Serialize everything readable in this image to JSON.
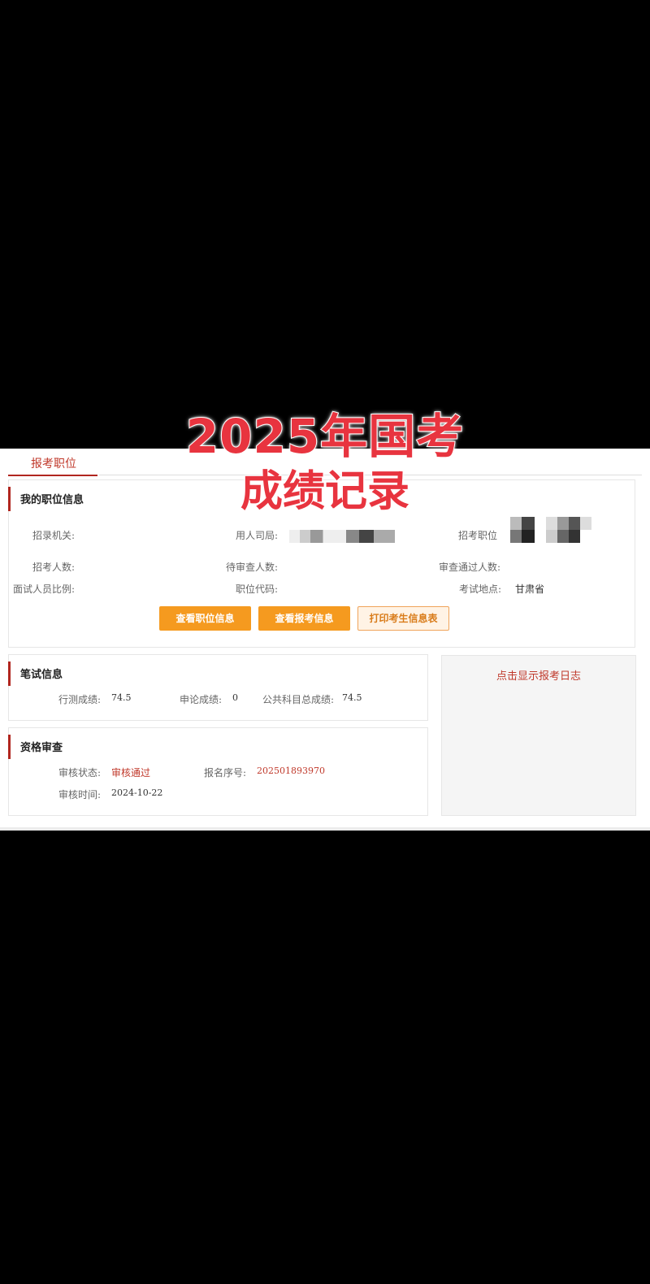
{
  "overlay": {
    "line1": "2025年国考",
    "line2": "成绩记录"
  },
  "tab": {
    "label": "报考职位"
  },
  "position_info": {
    "title": "我的职位信息",
    "fields": {
      "agency_label": "招录机关:",
      "employer_label": "用人司局:",
      "position_label": "招考职位",
      "recruit_count_label": "招考人数:",
      "pending_count_label": "待审查人数:",
      "passed_count_label": "审查通过人数:",
      "interview_ratio_label": "面试人员比例:",
      "position_code_label": "职位代码:",
      "exam_location_label": "考试地点:",
      "exam_location_value": "甘肃省"
    },
    "buttons": {
      "view_position": "查看职位信息",
      "view_registration": "查看报考信息",
      "print_candidate": "打印考生信息表"
    }
  },
  "written_exam": {
    "title": "笔试信息",
    "aptitude_label": "行测成绩:",
    "aptitude_value": "74.5",
    "essay_label": "申论成绩:",
    "essay_value": "0",
    "total_label": "公共科目总成绩:",
    "total_value": "74.5"
  },
  "qualification": {
    "title": "资格审查",
    "status_label": "审核状态:",
    "status_value": "审核通过",
    "reg_no_label": "报名序号:",
    "reg_no_value": "202501893970",
    "time_label": "审核时间:",
    "time_value": "2024-10-22"
  },
  "log_panel": {
    "link": "点击显示报考日志"
  },
  "colors": {
    "accent_red": "#b1261f",
    "button_orange": "#f59a1f",
    "headline_red": "#e8343f"
  }
}
